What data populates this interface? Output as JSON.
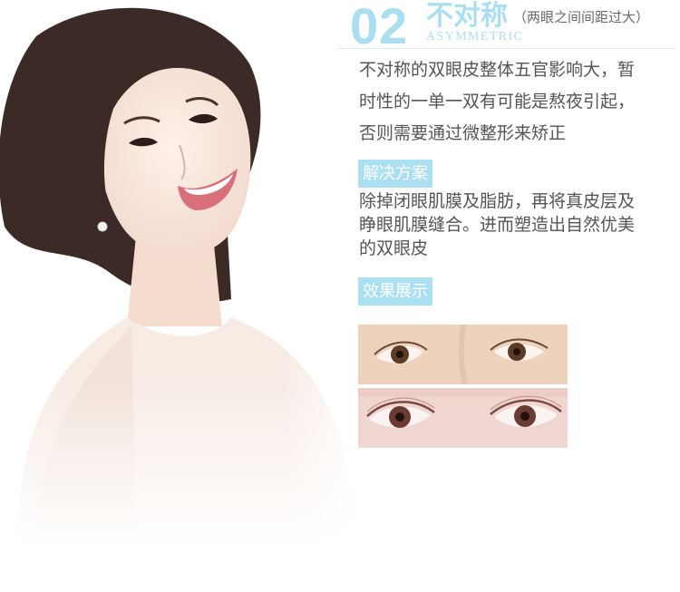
{
  "section": {
    "number": "02",
    "title": "不对称",
    "subtitle": "（两眼之间间距过大）",
    "english_title": "ASYMMETRIC"
  },
  "description": {
    "line1": "不对称的双眼皮整体五官影响大，暂",
    "line2": "时性的一单一双有可能是熬夜引起，",
    "line3": "否则需要通过微整形来矫正"
  },
  "solution": {
    "label": "解决方案",
    "line1": "除掉闭眼肌膜及脂肪，再将真皮层及",
    "line2": "睁眼肌膜缝合。进而塑造出自然优美",
    "line3": "的双眼皮"
  },
  "result": {
    "label": "效果展示"
  },
  "colors": {
    "accent": "#abdff2",
    "text": "#555555",
    "subtitle": "#6a6a6a"
  }
}
